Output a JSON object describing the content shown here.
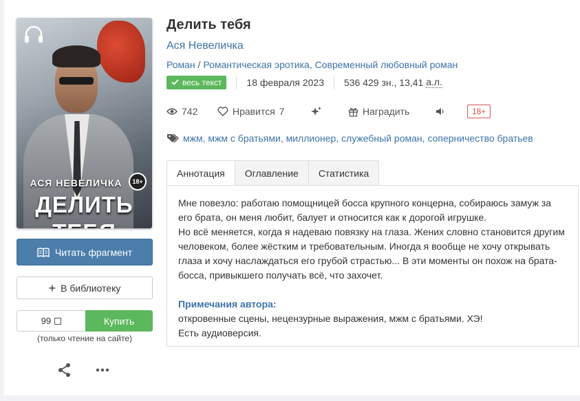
{
  "book": {
    "title": "Делить тебя",
    "author": "Ася Невеличка",
    "genres": [
      "Роман",
      "Романтическая эротика",
      "Современный любовный роман"
    ],
    "genre_sep": "/",
    "genre_sep2": ",",
    "status_badge": "весь текст",
    "date": "18 февраля 2023",
    "size_chars": "536 429 зн., 13,41",
    "size_unit": "а.л."
  },
  "cover": {
    "author_text": "АСЯ НЕВЕЛИЧКА",
    "title_text": "ДЕЛИТЬ ТЕБЯ",
    "age_badge": "18+"
  },
  "actions": {
    "read_fragment": "Читать фрагмент",
    "add_library": "В библиотеку",
    "price": "99",
    "buy": "Купить",
    "note": "(только чтение на сайте)"
  },
  "stats": {
    "views": "742",
    "likes_label": "Нравится",
    "likes": "7",
    "reward": "Наградить",
    "age_rating": "18+"
  },
  "tags": [
    "мжм",
    "мжм с братьями",
    "миллионер",
    "служебный роман",
    "соперничество братьев"
  ],
  "tabs": [
    "Аннотация",
    "Оглавление",
    "Статистика"
  ],
  "annotation": "Мне повезло: работаю помощницей босса крупного концерна, собираюсь замуж за его брата, он меня любит, балует и относится как к дорогой игрушке.\nНо всё меняется, когда я надеваю повязку на глаза. Жених словно становится другим человеком, более жёстким и требовательным. Иногда я вообще не хочу открывать глаза и хочу наслаждаться его грубой страстью... В эти моменты он похож на брата-босса, привыкшего получать всё, что захочет.",
  "author_notes": {
    "heading": "Примечания автора:",
    "text": "откровенные сцены, нецензурные выражения, мжм с братьями. ХЭ!\nЕсть аудиоверсия."
  },
  "colors": {
    "link": "#3d73a8",
    "primary": "#4b7eab",
    "success": "#5cb85c",
    "danger": "#d9534f"
  }
}
